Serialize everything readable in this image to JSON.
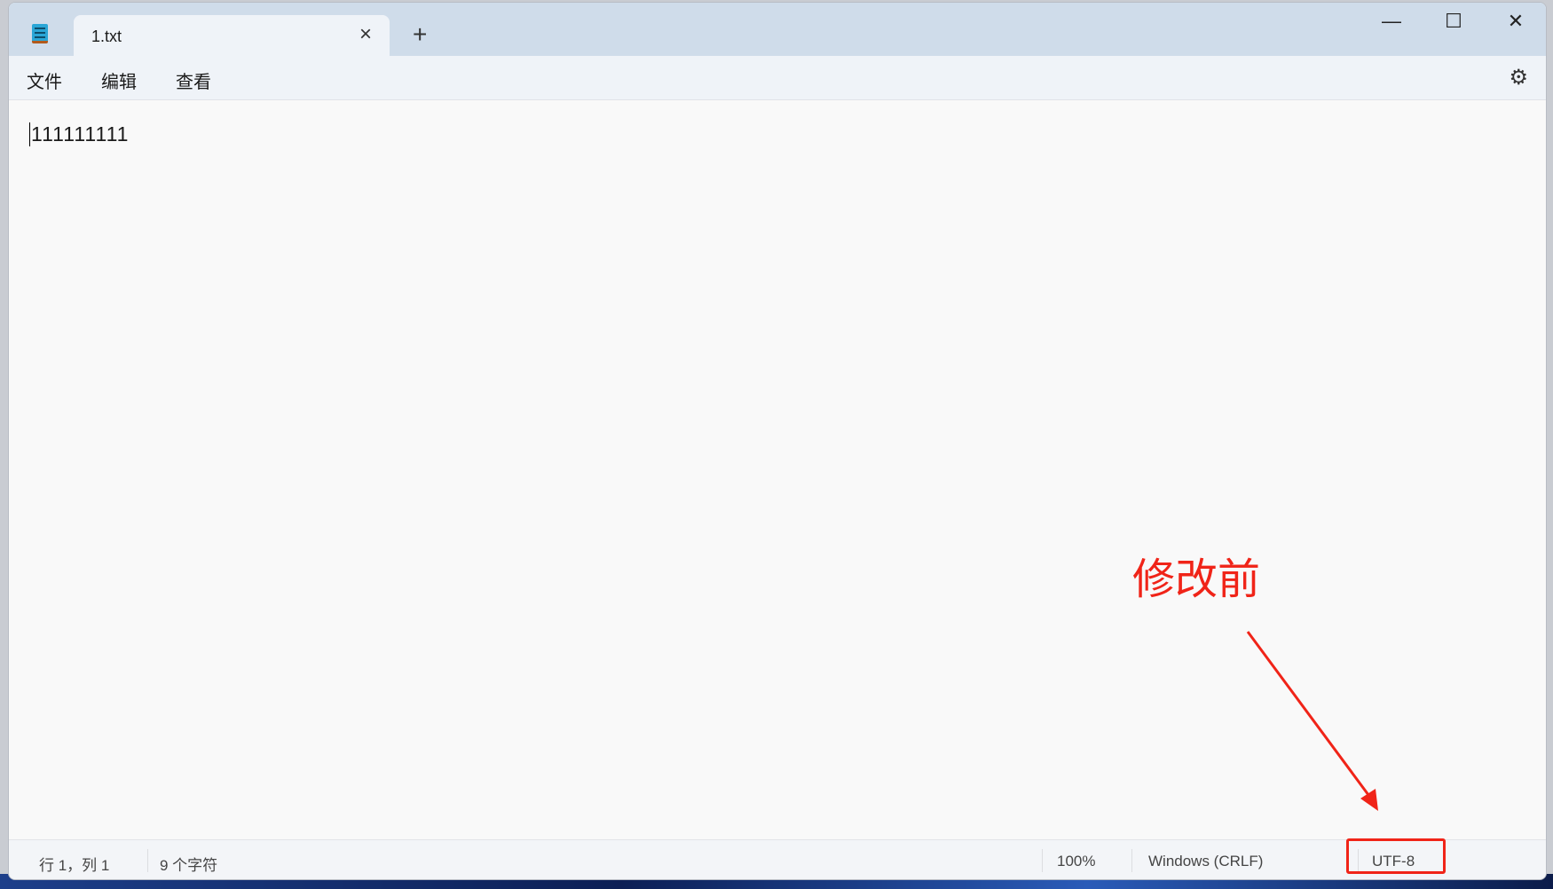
{
  "window": {
    "tab_title": "1.txt",
    "new_tab": "+",
    "minimize": "—",
    "maximize": "☐",
    "close": "✕",
    "tab_close": "×"
  },
  "menu": {
    "file": "文件",
    "edit": "编辑",
    "view": "查看",
    "settings_icon": "⚙"
  },
  "editor": {
    "content": "111111111"
  },
  "status": {
    "position": "行 1，列 1",
    "chars": "9 个字符",
    "zoom": "100%",
    "line_ending": "Windows (CRLF)",
    "encoding": "UTF-8"
  },
  "annotation": {
    "label": "修改前",
    "color": "#f02418"
  }
}
